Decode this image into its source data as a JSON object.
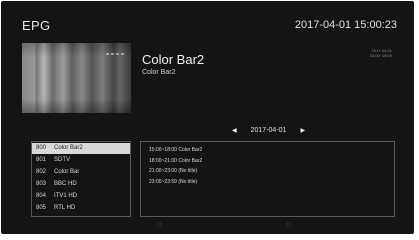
{
  "header": {
    "title": "EPG",
    "datetime": "2017-04-01 15:00:23"
  },
  "current_program": {
    "title": "Color Bar2",
    "subtitle": "Color Bar2",
    "time_date": "2017-04-01",
    "time_range": "15:00~18:00"
  },
  "date_nav": {
    "prev_icon": "left-arrow-icon",
    "date": "2017-04-01",
    "next_icon": "right-arrow-icon"
  },
  "channels": [
    {
      "number": "800",
      "name": "Color Bar2",
      "selected": true
    },
    {
      "number": "801",
      "name": "SDTV",
      "selected": false
    },
    {
      "number": "802",
      "name": "Color Bar",
      "selected": false
    },
    {
      "number": "803",
      "name": "BBC HD",
      "selected": false
    },
    {
      "number": "804",
      "name": "ITV1 HD",
      "selected": false
    },
    {
      "number": "805",
      "name": "RTL HD",
      "selected": false
    }
  ],
  "schedule": [
    {
      "text": "15:00~18:00 Color Bar2"
    },
    {
      "text": "18:00~21:00 Color Bar2"
    },
    {
      "text": "21:00~23:00 (No title)"
    },
    {
      "text": "23:00~23:59 (No title)"
    }
  ],
  "colors": {
    "background": "#141414",
    "selected_row": "#d8d8d8",
    "border": "#5a5a5a"
  }
}
